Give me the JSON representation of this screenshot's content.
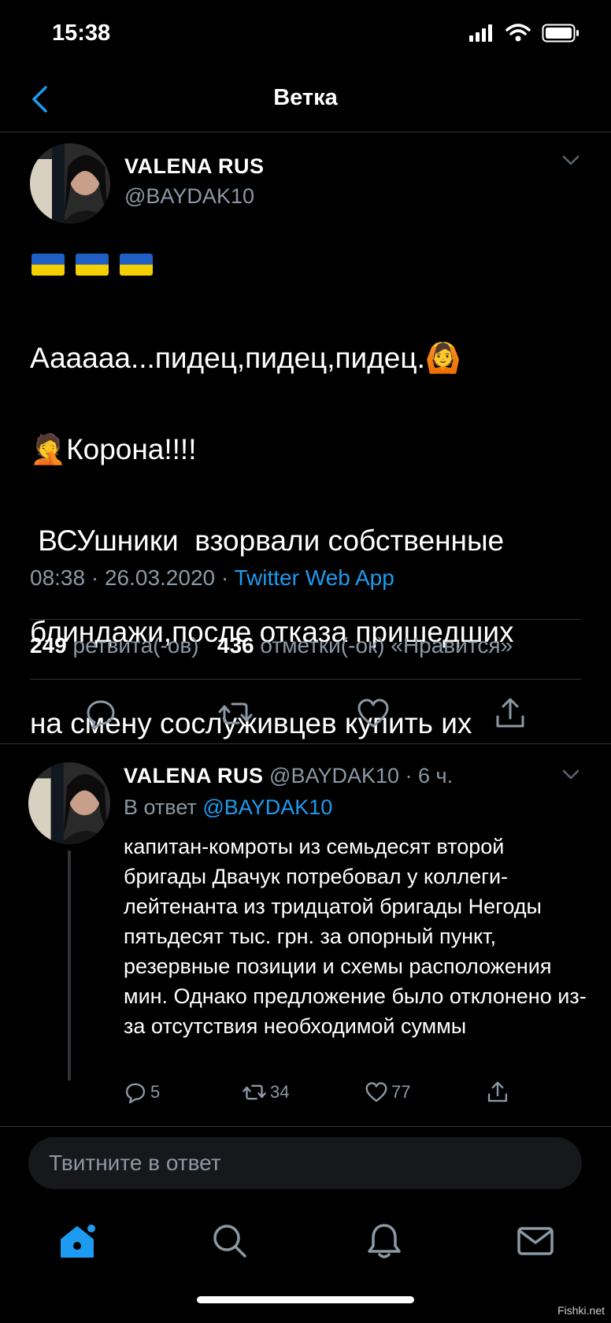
{
  "status": {
    "time": "15:38"
  },
  "nav": {
    "title": "Ветка"
  },
  "main_tweet": {
    "name": "VALENA RUS",
    "handle": "@BAYDAK10",
    "line1": "Аааааа...пидец,пидец,пидец.🙆",
    "line2": "🤦Корона!!!!",
    "line3": " ВСУшники  взорвали собственные",
    "line4": "блиндажи,после отказа пришедших",
    "line5": "на смену сослуживцев купить их",
    "time": "08:38 · 26.03.2020 · ",
    "source": "Twitter Web App",
    "retweets": "249",
    "retweets_label": "ретвита(-ов)",
    "likes": "436",
    "likes_label": "отметки(-ок) «Нравится»"
  },
  "reply_tweet": {
    "name": "VALENA RUS",
    "handle_time": "@BAYDAK10 · 6 ч.",
    "reply_prefix": "В ответ",
    "reply_to": "@BAYDAK10",
    "text": "капитан-комроты из семьдесят второй бригады Двачук потребовал у коллеги-лейтенанта из тридцатой бригады Негоды пятьдесят тыс. грн. за опорный пункт, резервные позиции и схемы расположения мин. Однако предложение было отклонено из-за отсутствия необходимой суммы",
    "replies": "5",
    "retweets": "34",
    "likes": "77"
  },
  "composer": {
    "placeholder": "Твитните в ответ"
  },
  "watermark": "Fishki.net",
  "colors": {
    "accent": "#1d9bf0",
    "muted": "#8b98a5",
    "divider": "#2f3336",
    "background": "#000000"
  }
}
